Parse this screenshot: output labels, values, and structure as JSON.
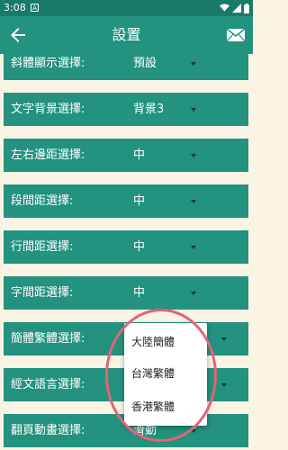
{
  "status_bar": {
    "time": "3:08",
    "notif_letter": "A"
  },
  "app_bar": {
    "title": "設置"
  },
  "settings": [
    {
      "label": "斜體顯示選擇:",
      "value": "預設"
    },
    {
      "label": "文字背景選擇:",
      "value": "背景3"
    },
    {
      "label": "左右邊距選擇:",
      "value": "中"
    },
    {
      "label": "段間距選擇:",
      "value": "中"
    },
    {
      "label": "行間距選擇:",
      "value": "中"
    },
    {
      "label": "字間距選擇:",
      "value": "中"
    },
    {
      "label": "簡體繁體選擇:",
      "value": ""
    },
    {
      "label": "經文語言選擇:",
      "value": ""
    },
    {
      "label": "翻頁動畫選擇:",
      "value": "滑動"
    }
  ],
  "dropdown": {
    "options": [
      "大陸簡體",
      "台灣繁體",
      "香港繁體"
    ]
  },
  "colors": {
    "accent": "#23927f",
    "status": "#1a7a6a",
    "background": "#faf4e4",
    "highlight": "#e06577"
  },
  "icons": {
    "back": "arrow-back-icon",
    "mail": "mail-icon"
  }
}
